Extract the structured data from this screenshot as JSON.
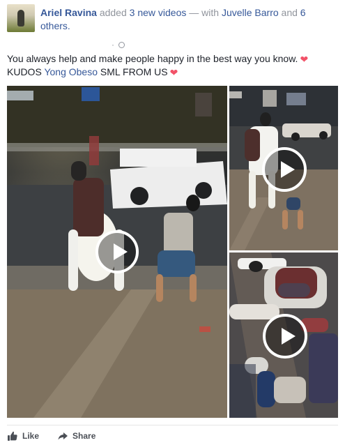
{
  "post": {
    "author": "Ariel Ravina",
    "action_text": "added",
    "new_videos_link": "3 new videos",
    "with_text": "— with",
    "tagged_user": "Juvelle Barro",
    "and_text": "and",
    "others_link": "6 others.",
    "timestamp": "·",
    "text_line1": "You always help and make people happy in the best way you know.",
    "text_line2_prefix": "KUDOS",
    "mention": "Yong Obeso",
    "text_line2_suffix": "SML FROM US"
  },
  "media": {
    "play_icon": "play-icon"
  },
  "actions": {
    "like_label": "Like",
    "share_label": "Share"
  },
  "icons": {
    "heart_icon": "heart-icon",
    "like_icon": "thumbs-up-icon",
    "share_icon": "share-arrow-icon"
  },
  "colors": {
    "link": "#365899",
    "meta_text": "#90949c",
    "body_text": "#1d2129",
    "heart": "#f25268"
  }
}
